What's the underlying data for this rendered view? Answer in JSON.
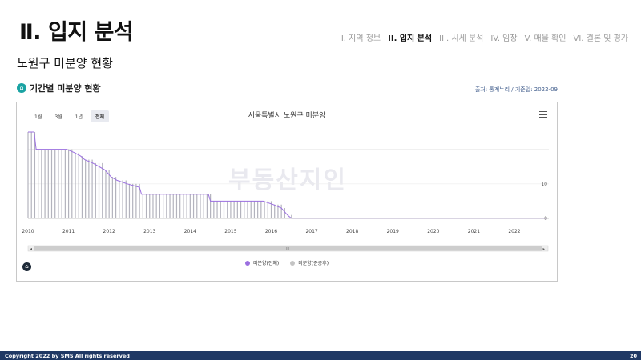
{
  "header": {
    "title": "Ⅱ. 입지 분석",
    "nav": [
      "I. 지역 정보",
      "II. 입지 분석",
      "III. 시세 분석",
      "IV. 임장",
      "V. 매물 확인",
      "VI. 결론 및 평가"
    ],
    "active_index": 1
  },
  "subtitle": "노원구 미분양 현황",
  "section": {
    "title": "기간별 미분양 현황",
    "source": "출처: 통계누리 / 기준일: 2022-09"
  },
  "range_buttons": [
    "1월",
    "3월",
    "1년",
    "전체"
  ],
  "selected_range": "전체",
  "watermark": "부동산지인",
  "footer": {
    "copyright": "Copyright 2022 by SMS All rights reserved",
    "page": "20"
  },
  "chart_data": {
    "type": "bar",
    "title": "서울특별시 노원구 미분양",
    "x_tick_labels": [
      "2010",
      "2011",
      "2012",
      "2013",
      "2014",
      "2015",
      "2016",
      "2017",
      "2018",
      "2019",
      "2020",
      "2021",
      "2022"
    ],
    "y_tick_labels": [
      "0",
      "10"
    ],
    "ylim": [
      0,
      25
    ],
    "grid": true,
    "legend_position": "bottom",
    "series": [
      {
        "name": "미분양(전체)",
        "color": "#9b6fe0",
        "points": [
          [
            2010.0,
            25
          ],
          [
            2010.15,
            25
          ],
          [
            2010.2,
            20
          ],
          [
            2010.95,
            20
          ],
          [
            2011.15,
            19
          ],
          [
            2011.3,
            18
          ],
          [
            2011.4,
            17
          ],
          [
            2011.6,
            16
          ],
          [
            2011.9,
            14
          ],
          [
            2012.05,
            12
          ],
          [
            2012.2,
            11
          ],
          [
            2012.45,
            10
          ],
          [
            2012.75,
            9
          ],
          [
            2012.8,
            7
          ],
          [
            2014.45,
            7
          ],
          [
            2014.5,
            5
          ],
          [
            2015.8,
            5
          ],
          [
            2016.05,
            4
          ],
          [
            2016.25,
            3
          ],
          [
            2016.4,
            1
          ],
          [
            2016.5,
            0
          ],
          [
            2022.8,
            0
          ]
        ]
      },
      {
        "name": "미분양(준공후)",
        "color": "#c4c4c4",
        "points": []
      }
    ],
    "navigator": {
      "scroll_label": "III"
    }
  }
}
